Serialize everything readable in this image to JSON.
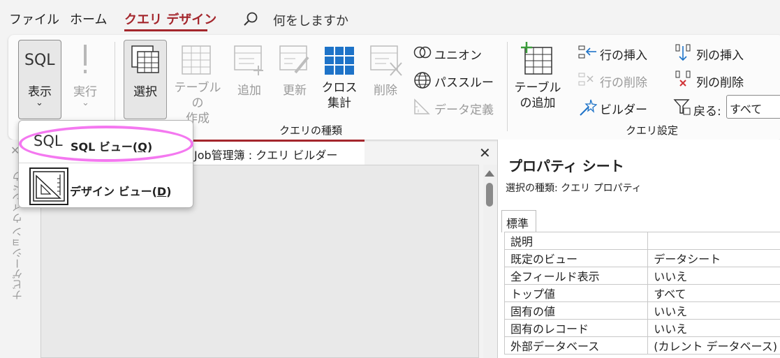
{
  "tabs": {
    "file": "ファイル",
    "home": "ホーム",
    "query_design": "クエリ デザイン",
    "search_placeholder": "何をしますか"
  },
  "ribbon": {
    "results": {
      "view_top": "SQL",
      "view_label": "表示",
      "run_label": "実行"
    },
    "query_type": {
      "select": "選択",
      "make_table_1": "テーブルの",
      "make_table_2": "作成",
      "append": "追加",
      "update": "更新",
      "crosstab_1": "クロス",
      "crosstab_2": "集計",
      "delete": "削除",
      "union": "ユニオン",
      "pass_through": "パススルー",
      "data_definition": "データ定義",
      "group_label": "クエリの種類"
    },
    "query_setup": {
      "add_tables_1": "テーブル",
      "add_tables_2": "の追加",
      "insert_rows": "行の挿入",
      "delete_rows": "行の削除",
      "builder": "ビルダー",
      "insert_columns": "列の挿入",
      "delete_columns": "列の削除",
      "return_label": "戻る:",
      "return_value": "すべて",
      "group_label": "クエリ設定"
    }
  },
  "dropdown": {
    "sql_icon_text": "SQL",
    "sql_view": "SQL ビュー(",
    "sql_view_key": "Q",
    "design_view": "デザイン ビュー(",
    "design_view_key": "D",
    "close_paren": ")"
  },
  "nav_pane": {
    "label": "ナビゲーション ウィンドウ"
  },
  "document": {
    "tab_title": "Job管理簿 : クエリ ビルダー"
  },
  "property_sheet": {
    "title": "プロパティ シート",
    "selection_type": "選択の種類:  クエリ プロパティ",
    "tab": "標準",
    "rows": [
      {
        "key": "説明",
        "value": ""
      },
      {
        "key": "既定のビュー",
        "value": "データシート"
      },
      {
        "key": "全フィールド表示",
        "value": "いいえ"
      },
      {
        "key": "トップ値",
        "value": "すべて"
      },
      {
        "key": "固有の値",
        "value": "いいえ"
      },
      {
        "key": "固有のレコード",
        "value": "いいえ"
      },
      {
        "key": "外部データベース",
        "value": "(カレント データベース)"
      }
    ]
  },
  "colors": {
    "accent": "#a4262c",
    "highlight": "#f478f0",
    "crosstab_blue": "#1e73c8"
  }
}
